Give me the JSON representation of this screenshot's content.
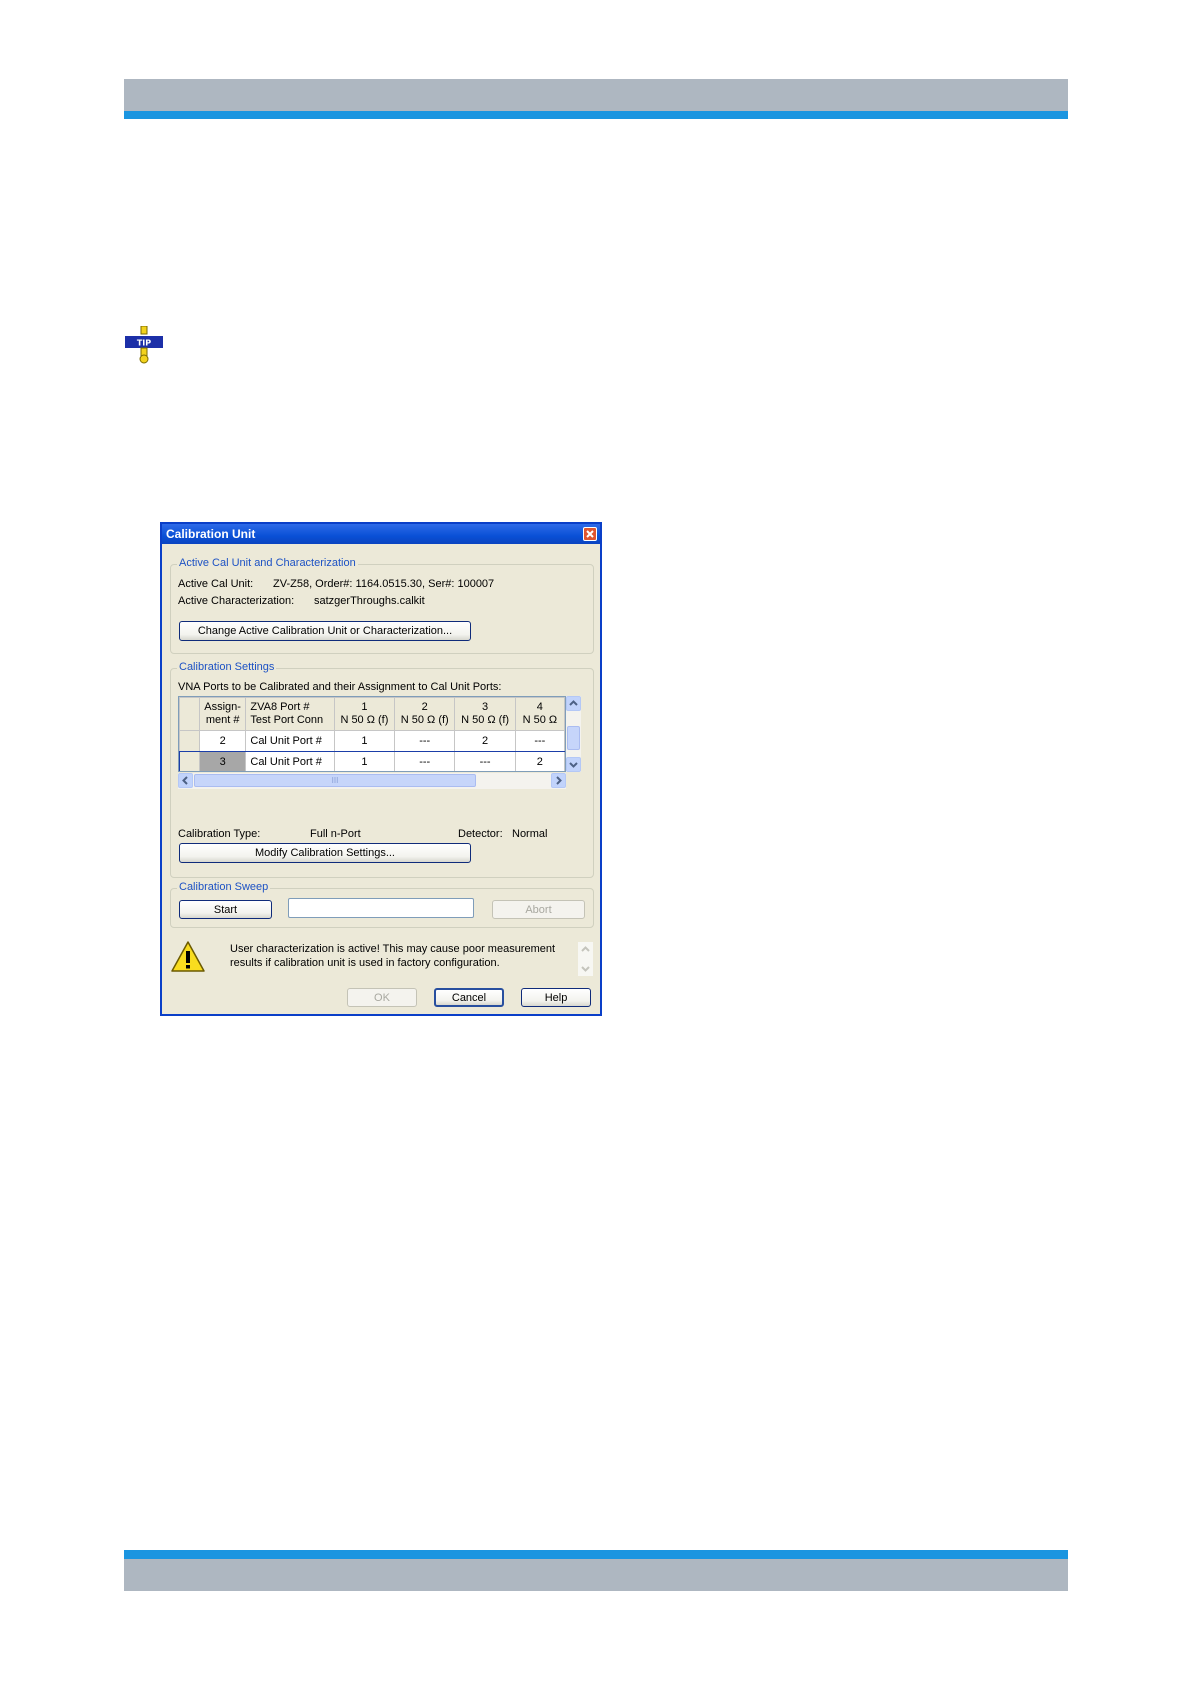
{
  "dialog": {
    "title": "Calibration Unit",
    "active_group": {
      "title": "Active Cal Unit and Characterization",
      "cal_unit_label": "Active Cal Unit:",
      "cal_unit_value": "ZV-Z58, Order#: 1164.0515.30, Ser#: 100007",
      "characterization_label": "Active Characterization:",
      "characterization_value": "satzgerThroughs.calkit",
      "change_button": "Change Active Calibration Unit or Characterization..."
    },
    "settings_group": {
      "title": "Calibration Settings",
      "caption": "VNA Ports to be Calibrated and their Assignment to Cal Unit Ports:",
      "table": {
        "headers": [
          [
            "Assign-",
            "ment #"
          ],
          [
            "ZVA8 Port #",
            "Test Port Conn"
          ],
          [
            "1",
            "N 50 Ω (f)"
          ],
          [
            "2",
            "N 50 Ω (f)"
          ],
          [
            "3",
            "N 50 Ω (f)"
          ],
          [
            "4",
            "N 50 Ω"
          ]
        ],
        "rows": [
          [
            "2",
            "Cal Unit Port #",
            "1",
            "---",
            "2",
            "---"
          ],
          [
            "3",
            "Cal Unit Port #",
            "1",
            "---",
            "---",
            "2"
          ]
        ]
      },
      "hscroll_thumb_mark": "III",
      "cal_type_label": "Calibration Type:",
      "cal_type_value": "Full n-Port",
      "detector_label": "Detector:",
      "detector_value": "Normal",
      "modify_button": "Modify Calibration Settings..."
    },
    "sweep_group": {
      "title": "Calibration Sweep",
      "start_button": "Start",
      "abort_button": "Abort"
    },
    "warning": {
      "line1": "User characterization is active! This may cause poor measurement",
      "line2": "results if calibration unit is used in factory configuration."
    },
    "ok_button": "OK",
    "cancel_button": "Cancel",
    "help_button": "Help"
  },
  "icons": {
    "tip": "tip-icon",
    "warning": "warning-icon",
    "close": "close-icon"
  },
  "colors": {
    "header_band": "#aeb7c1",
    "accent_blue": "#1b95e0",
    "dialog_titlebar": "#0950d6",
    "dialog_background": "#ece9d8"
  },
  "tip_text": "TIP"
}
